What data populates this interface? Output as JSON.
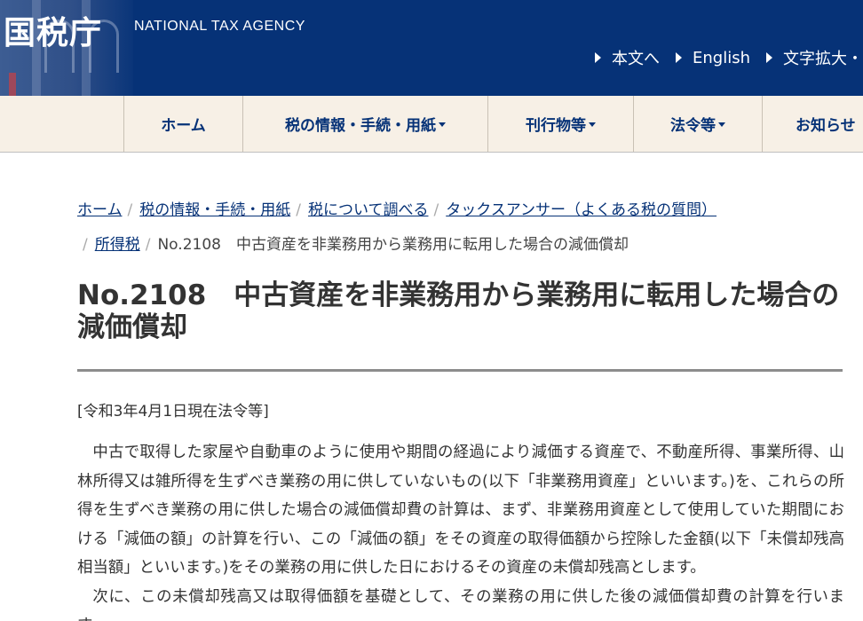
{
  "header": {
    "logo": "国税庁",
    "agency_name": "NATIONAL TAX AGENCY",
    "util_links": [
      "本文へ",
      "English",
      "文字拡大・"
    ]
  },
  "nav": {
    "items": [
      "ホーム",
      "税の情報・手続・用紙",
      "刊行物等",
      "法令等",
      "お知らせ"
    ]
  },
  "breadcrumb": {
    "links": [
      "ホーム",
      "税の情報・手続・用紙",
      "税について調べる",
      "タックスアンサー（よくある税の質問）",
      "所得税"
    ],
    "current": "No.2108　中古資産を非業務用から業務用に転用した場合の減価償却"
  },
  "page": {
    "title": "No.2108　中古資産を非業務用から業務用に転用した場合の減価償却",
    "as_of": "[令和3年4月1日現在法令等]",
    "paragraph1": "中古で取得した家屋や自動車のように使用や期間の経過により減価する資産で、不動産所得、事業所得、山林所得又は雑所得を生ずべき業務の用に供していないもの(以下「非業務用資産」といいます。)を、これらの所得を生ずべき業務の用に供した場合の減価償却費の計算は、まず、非業務用資産として使用していた期間における「減価の額」の計算を行い、この「減価の額」をその資産の取得価額から控除した金額(以下「未償却残高相当額」といいます。)をその業務の用に供した日におけるその資産の未償却残高とします。",
    "paragraph2": "次に、この未償却残高又は取得価額を基礎として、その業務の用に供した後の減価償却費の計算を行います。"
  },
  "colors": {
    "header_bg": "#063277",
    "nav_bg": "#f7f0e6",
    "link": "#063277"
  }
}
